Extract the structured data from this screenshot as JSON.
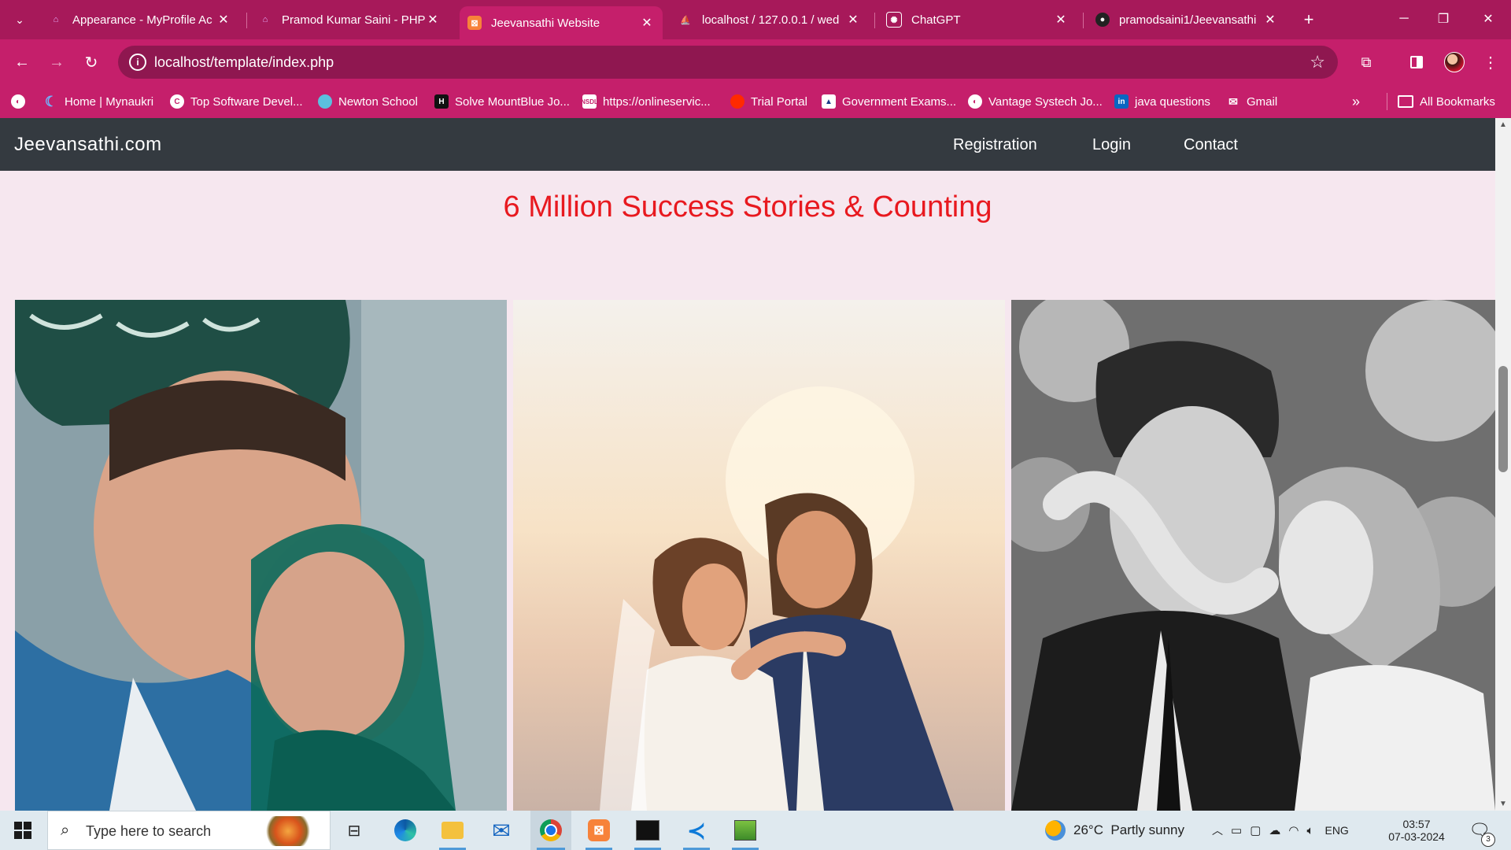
{
  "browser": {
    "tabs": [
      {
        "label": "Appearance - MyProfile Ac",
        "icon": "profile-icon"
      },
      {
        "label": "Pramod Kumar Saini - PHP",
        "icon": "profile-icon"
      },
      {
        "label": "Jeevansathi Website",
        "icon": "xampp-icon",
        "active": true
      },
      {
        "label": "localhost / 127.0.0.1 / wed",
        "icon": "phpmyadmin-icon"
      },
      {
        "label": "ChatGPT",
        "icon": "chatgpt-icon"
      },
      {
        "label": "pramodsaini1/Jeevansathi",
        "icon": "github-icon"
      }
    ],
    "url": "localhost/template/index.php",
    "bookmarks": [
      {
        "label": "Home | Mynaukri"
      },
      {
        "label": "Top Software Devel..."
      },
      {
        "label": "Newton School"
      },
      {
        "label": "Solve MountBlue Jo..."
      },
      {
        "label": "https://onlineservic..."
      },
      {
        "label": "Trial Portal"
      },
      {
        "label": "Government Exams..."
      },
      {
        "label": "Vantage Systech Jo..."
      },
      {
        "label": "java questions"
      },
      {
        "label": "Gmail"
      }
    ],
    "all_bookmarks": "All Bookmarks"
  },
  "site": {
    "brand": "Jeevansathi.com",
    "nav": [
      "Registration",
      "Login",
      "Contact"
    ],
    "headline": "6 Million Success Stories & Counting"
  },
  "taskbar": {
    "search_placeholder": "Type here to search",
    "weather": "26°C  Partly sunny",
    "language": "ENG",
    "time": "03:57",
    "date": "07-03-2024",
    "notifications": "3"
  },
  "colors": {
    "chrome_accent": "#c51f6b",
    "tabbar": "#a7195a",
    "navbar": "#343a40",
    "headline": "#e8191f",
    "page_bg": "#f6e7ef"
  }
}
